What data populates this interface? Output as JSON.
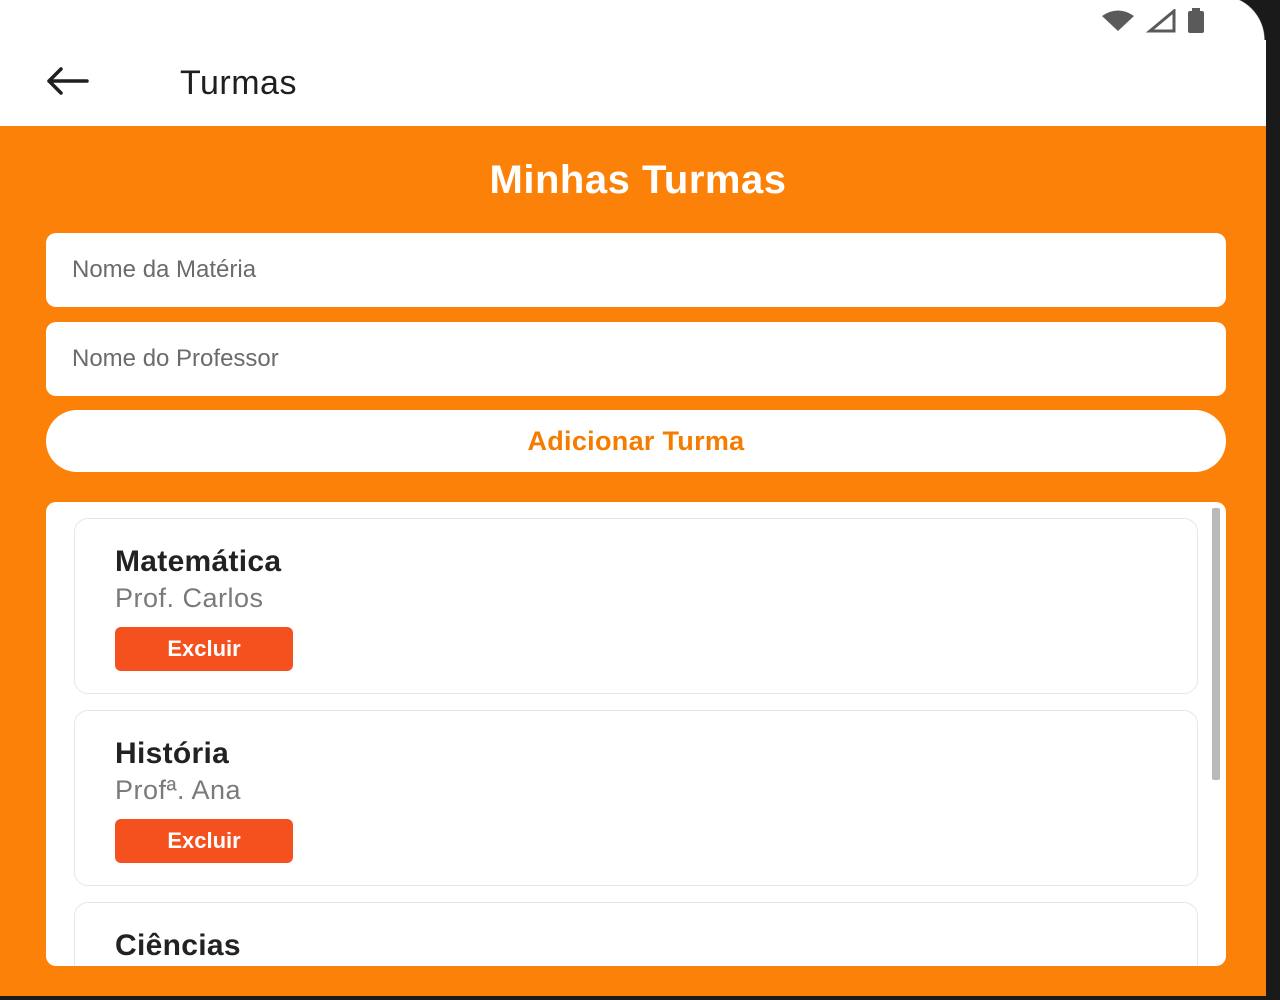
{
  "app_bar": {
    "title": "Turmas",
    "back_icon": "arrow-left-icon"
  },
  "status_bar": {
    "icons": [
      "wifi-icon",
      "signal-icon",
      "battery-icon"
    ]
  },
  "main": {
    "heading": "Minhas Turmas",
    "subject_input": {
      "value": "",
      "placeholder": "Nome da Matéria"
    },
    "teacher_input": {
      "value": "",
      "placeholder": "Nome do Professor"
    },
    "add_button_label": "Adicionar Turma",
    "classes": [
      {
        "subject": "Matemática",
        "teacher": "Prof. Carlos",
        "delete_label": "Excluir"
      },
      {
        "subject": "História",
        "teacher": "Profª. Ana",
        "delete_label": "Excluir"
      },
      {
        "subject": "Ciências"
      }
    ]
  },
  "colors": {
    "primary_orange": "#fb8109",
    "button_text_orange": "#f57c00",
    "delete_red": "#f4511e",
    "white": "#ffffff"
  }
}
